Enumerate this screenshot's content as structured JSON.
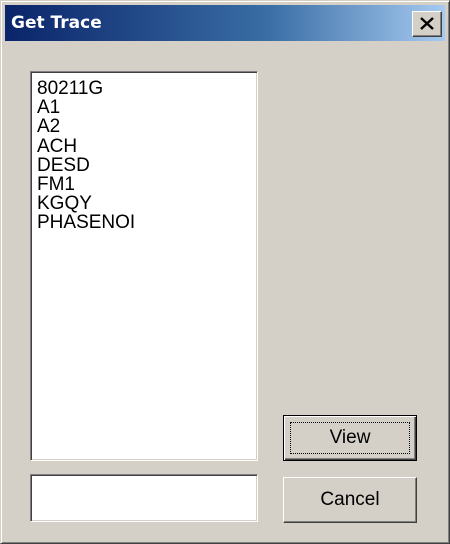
{
  "window": {
    "title": "Get Trace"
  },
  "colors": {
    "face": "#d4d0c8",
    "title_start": "#0a246a",
    "title_end": "#a6caf0"
  },
  "icons": {
    "close": "close-icon"
  },
  "trace_list": {
    "items": [
      {
        "label": "80211G"
      },
      {
        "label": "A1"
      },
      {
        "label": "A2"
      },
      {
        "label": "ACH"
      },
      {
        "label": "DESD"
      },
      {
        "label": "FM1"
      },
      {
        "label": "KGQY"
      },
      {
        "label": "PHASENOI"
      }
    ]
  },
  "trace_name_field": {
    "value": "",
    "placeholder": ""
  },
  "buttons": {
    "view_label": "View",
    "cancel_label": "Cancel"
  }
}
